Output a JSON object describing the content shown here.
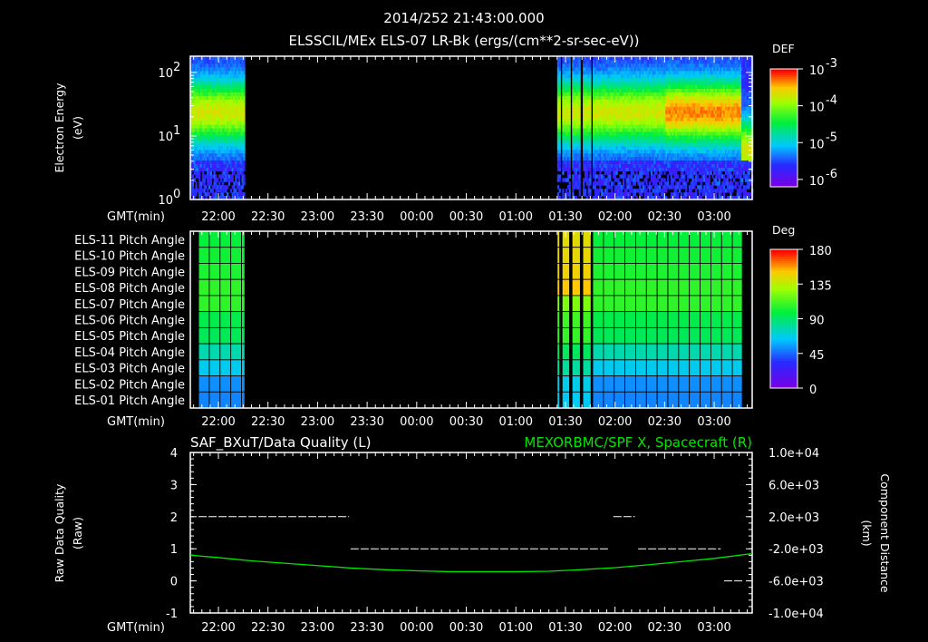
{
  "header": {
    "datetime": "2014/252 21:43:00.000",
    "subtitle": "ELSSCIL/MEx ELS-07 LR-Bk  (ergs/(cm**2-sr-sec-eV))"
  },
  "chart_data": [
    {
      "type": "heatmap",
      "name": "electron-energy-spectrogram",
      "ylabel": [
        "Electron Energy",
        "(eV)"
      ],
      "xlabel": "GMT(min)",
      "yscale": "log",
      "ylim": [
        1,
        180
      ],
      "yticks": [
        {
          "v": 1,
          "base": "10",
          "exp": "0"
        },
        {
          "v": 10,
          "base": "10",
          "exp": "1"
        },
        {
          "v": 100,
          "base": "10",
          "exp": "2"
        }
      ],
      "xlim_min_after_2100": [
        43,
        383
      ],
      "xticks": [
        "22:00",
        "22:30",
        "23:00",
        "23:30",
        "00:00",
        "00:30",
        "01:00",
        "01:30",
        "02:00",
        "02:30",
        "03:00"
      ],
      "data_segments_min_after_2100": [
        [
          43,
          76
        ],
        [
          265,
          266.5
        ],
        [
          268,
          272.5
        ],
        [
          274,
          279
        ],
        [
          280.5,
          285.5
        ],
        [
          286.5,
          383
        ]
      ],
      "colorbar": {
        "title": "DEF",
        "labels": [
          {
            "base": "10",
            "exp": "-3"
          },
          {
            "base": "10",
            "exp": "-4"
          },
          {
            "base": "10",
            "exp": "-5"
          },
          {
            "base": "10",
            "exp": "-6"
          }
        ],
        "log_range": [
          -6.2,
          -3.0
        ]
      }
    },
    {
      "type": "heatmap",
      "name": "pitch-angle",
      "xlabel": "GMT(min)",
      "rows": [
        "ELS-11 Pitch Angle",
        "ELS-10 Pitch Angle",
        "ELS-09 Pitch Angle",
        "ELS-08 Pitch Angle",
        "ELS-07 Pitch Angle",
        "ELS-06 Pitch Angle",
        "ELS-05 Pitch Angle",
        "ELS-04 Pitch Angle",
        "ELS-03 Pitch Angle",
        "ELS-02 Pitch Angle",
        "ELS-01 Pitch Angle"
      ],
      "pitch_deg": [
        100,
        102,
        104,
        108,
        108,
        96,
        94,
        78,
        66,
        52,
        50
      ],
      "data_segments_min_after_2100": [
        [
          48,
          76
        ],
        [
          265,
          266.5
        ],
        [
          268,
          272.5
        ],
        [
          274,
          279
        ],
        [
          280.5,
          285.5
        ],
        [
          286.5,
          377
        ]
      ],
      "colorbar": {
        "title": "Deg",
        "labels": [
          "180",
          "135",
          "90",
          "45",
          "0"
        ],
        "range": [
          0,
          180
        ]
      }
    },
    {
      "type": "line",
      "name": "data-quality-and-position",
      "left_title": "SAF_BXuT/Data Quality (L)",
      "right_title": "MEXORBMC/SPF X, Spacecraft (R)",
      "ylabel_left": [
        "Raw Data Quality",
        "(Raw)"
      ],
      "ylabel_right": [
        "Component Distance",
        "(km)"
      ],
      "xlabel": "GMT(min)",
      "ylim_left": [
        -1,
        4
      ],
      "yticks_left": [
        "4",
        "3",
        "2",
        "1",
        "0",
        "-1"
      ],
      "ylim_right": [
        -10000,
        10000
      ],
      "yticks_right": [
        "1.0e+04",
        "6.0e+03",
        "2.0e+03",
        "-2.0e+03",
        "-6.0e+03",
        "-1.0e+04"
      ],
      "quality_segments": [
        {
          "from": 48,
          "to": 139,
          "value": 2
        },
        {
          "from": 140,
          "to": 296,
          "value": 1
        },
        {
          "from": 299,
          "to": 312,
          "value": 2
        },
        {
          "from": 314,
          "to": 364,
          "value": 1
        },
        {
          "from": 366,
          "to": 377,
          "value": 0
        }
      ],
      "spacecraft_x_km": {
        "x": [
          43,
          60,
          80,
          100,
          120,
          140,
          160,
          180,
          200,
          220,
          240,
          260,
          280,
          300,
          320,
          340,
          360,
          383
        ],
        "y": [
          -2800,
          -3100,
          -3500,
          -3800,
          -4100,
          -4400,
          -4600,
          -4750,
          -4850,
          -4850,
          -4850,
          -4800,
          -4600,
          -4350,
          -4000,
          -3600,
          -3200,
          -2600
        ]
      }
    }
  ],
  "colors": {
    "white": "#ffffff",
    "green": "#00e600",
    "background": "#000000"
  }
}
